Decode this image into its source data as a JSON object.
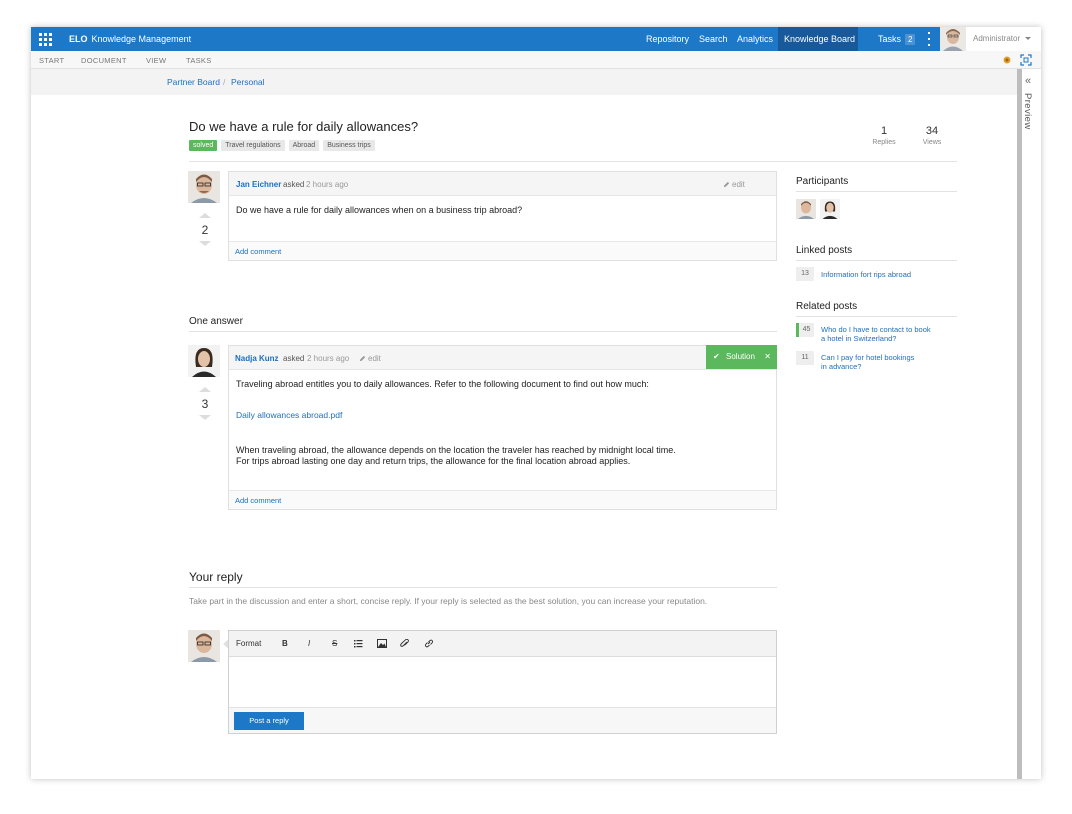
{
  "topbar": {
    "brand_bold": "ELO",
    "brand_text": "Knowledge Management",
    "nav": [
      "Repository",
      "Search",
      "Analytics",
      "Knowledge Board",
      "Tasks"
    ],
    "tasks_count": "2",
    "user": "Administrator"
  },
  "ribbon": [
    "START",
    "DOCUMENT",
    "VIEW",
    "TASKS"
  ],
  "breadcrumb": [
    "Partner Board",
    "Personal"
  ],
  "preview_label": "Preview",
  "question": {
    "title": "Do we have a rule for daily allowances?",
    "tags": [
      "solved",
      "Travel regulations",
      "Abroad",
      "Business trips"
    ],
    "replies": "1",
    "replies_label": "Replies",
    "views": "34",
    "views_label": "Views",
    "author": "Jan Eichner",
    "asked_label": "asked",
    "time": "2 hours ago",
    "edit_label": "edit",
    "votes": "2",
    "body": "Do we have a rule for daily allowances when on a business trip abroad?",
    "add_comment": "Add comment"
  },
  "answers_heading": "One answer",
  "answer": {
    "author": "Nadja Kunz",
    "asked_label": "asked",
    "time": "2 hours ago",
    "edit_label": "edit",
    "solution_label": "Solution",
    "votes": "3",
    "line1": "Traveling abroad entitles you to daily allowances. Refer to the following document to find out how much:",
    "link": "Daily allowances abroad.pdf",
    "line2": "When traveling abroad, the allowance depends on the location the traveler has reached by midnight local time.",
    "line3": "For trips abroad lasting one day and return trips, the allowance for the final location abroad applies.",
    "add_comment": "Add comment"
  },
  "sidebar": {
    "participants_heading": "Participants",
    "linked_heading": "Linked posts",
    "linked": [
      {
        "count": "13",
        "text": "Information fort rips abroad"
      }
    ],
    "related_heading": "Related posts",
    "related": [
      {
        "count": "45",
        "line1": "Who do I have to contact to book",
        "line2": "a hotel in Switzerland?"
      },
      {
        "count": "11",
        "line1": "Can I pay for hotel bookings",
        "line2": "in advance?"
      }
    ]
  },
  "reply": {
    "heading": "Your reply",
    "hint": "Take part in the discussion and enter a short, concise reply. If your reply is selected as the best solution, you can increase your reputation.",
    "format_label": "Format",
    "bold": "B",
    "italic": "I",
    "strike": "S",
    "post_button": "Post a reply"
  },
  "colors": {
    "topbar": "#1e78c8",
    "active_nav": "#17599a",
    "link": "#1e6fbe",
    "solved_green": "#5cb85c"
  }
}
